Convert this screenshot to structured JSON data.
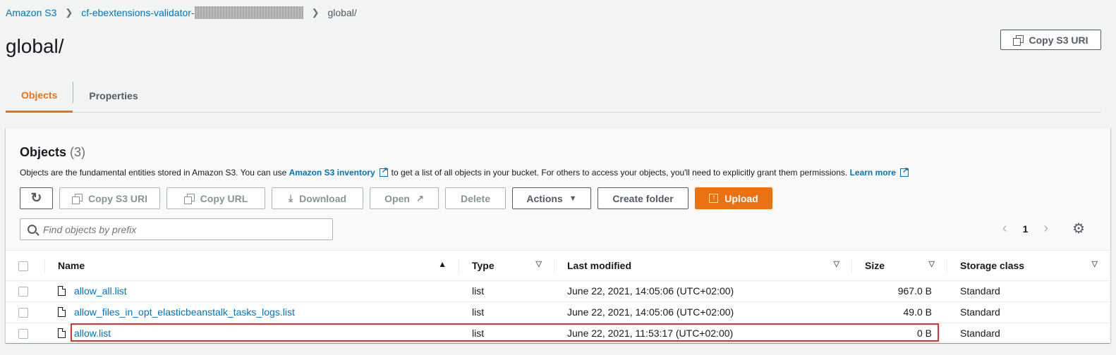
{
  "breadcrumb": {
    "root": "Amazon S3",
    "bucket": "cf-ebextensions-validator-",
    "current": "global/"
  },
  "page": {
    "title": "global/",
    "copy_uri_label": "Copy S3 URI"
  },
  "tabs": [
    {
      "label": "Objects",
      "active": true
    },
    {
      "label": "Properties",
      "active": false
    }
  ],
  "objects": {
    "title": "Objects",
    "count": "(3)",
    "desc_prefix": "Objects are the fundamental entities stored in Amazon S3. You can use",
    "inventory_link": "Amazon S3 inventory",
    "desc_suffix": "to get a list of all objects in your bucket. For others to access your objects, you'll need to explicitly grant them permissions.",
    "learn_more": "Learn more",
    "toolbar": {
      "copy_uri": "Copy S3 URI",
      "copy_url": "Copy URL",
      "download": "Download",
      "open": "Open",
      "delete": "Delete",
      "actions": "Actions",
      "create_folder": "Create folder",
      "upload": "Upload"
    },
    "search_placeholder": "Find objects by prefix",
    "page_number": "1",
    "columns": {
      "name": "Name",
      "type": "Type",
      "last_modified": "Last modified",
      "size": "Size",
      "storage_class": "Storage class"
    },
    "rows": [
      {
        "name": "allow_all.list",
        "type": "list",
        "modified": "June 22, 2021, 14:05:06 (UTC+02:00)",
        "size": "967.0 B",
        "storage": "Standard"
      },
      {
        "name": "allow_files_in_opt_elasticbeanstalk_tasks_logs.list",
        "type": "list",
        "modified": "June 22, 2021, 14:05:06 (UTC+02:00)",
        "size": "49.0 B",
        "storage": "Standard"
      },
      {
        "name": "allow.list",
        "type": "list",
        "modified": "June 22, 2021, 11:53:17 (UTC+02:00)",
        "size": "0 B",
        "storage": "Standard"
      }
    ]
  },
  "colors": {
    "accent": "#ec7211",
    "link": "#0073bb",
    "highlight": "#e0332b"
  }
}
